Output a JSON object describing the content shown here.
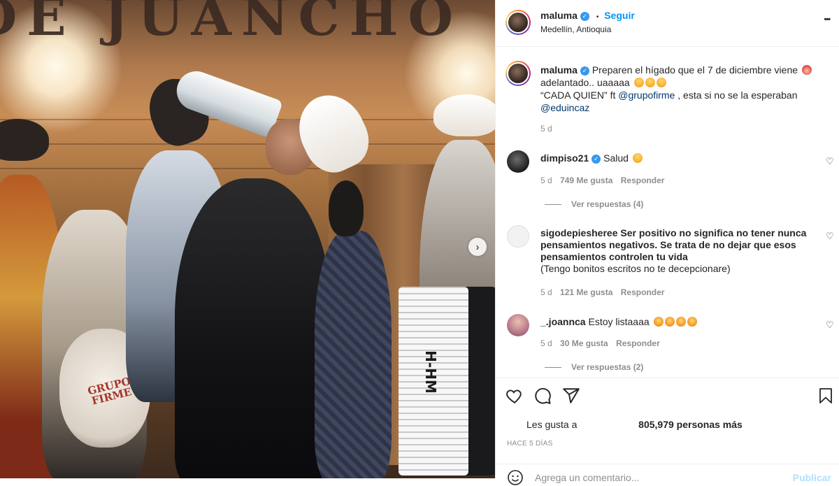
{
  "post": {
    "photo": {
      "sign_text": "DE JUANCHO",
      "guitar_text": "GRUPO FIRME",
      "accordion_text": "H-HM"
    },
    "nav_next_label": "›"
  },
  "header": {
    "username": "maluma",
    "location": "Medellín, Antioquia",
    "follow_label": "Seguir",
    "separator": "•",
    "more_label": "•••"
  },
  "caption": {
    "username": "maluma",
    "text_1": "Preparen el hígado que el 7 de diciembre viene",
    "text_2": "adelantado.. uaaaaa",
    "text_3_quote": "“CADA QUIEN” ft",
    "mention_1": "@grupofirme",
    "text_3_rest": ", esta si no se la esperaban",
    "mention_2": "@eduincaz",
    "time": "5 d"
  },
  "comments": [
    {
      "username": "dimpiso21",
      "verified": true,
      "text": "Salud",
      "time": "5 d",
      "likes": "749 Me gusta",
      "reply": "Responder",
      "view_replies": "Ver respuestas (4)"
    },
    {
      "username": "sigodepiesheree",
      "verified": false,
      "text_bold": "Ser positivo no significa no tener nunca pensamientos negativos. Se trata de no dejar que esos pensamientos controlen tu vida",
      "text": "(Tengo bonitos escritos no te decepcionare)",
      "time": "5 d",
      "likes": "121 Me gusta",
      "reply": "Responder"
    },
    {
      "username": "_.joannca",
      "verified": false,
      "text": "Estoy listaaaa",
      "time": "5 d",
      "likes": "30 Me gusta",
      "reply": "Responder",
      "view_replies": "Ver respuestas (2)"
    }
  ],
  "actions": {
    "likes_prefix": "Les gusta a",
    "likes_count": "805,979 personas más",
    "date": "HACE 5 DÍAS",
    "comment_placeholder": "Agrega un comentario...",
    "publish_label": "Publicar"
  },
  "colors": {
    "accent": "#0095f6",
    "verified": "#3897f0",
    "text": "#262626",
    "muted": "#8e8e8e"
  }
}
